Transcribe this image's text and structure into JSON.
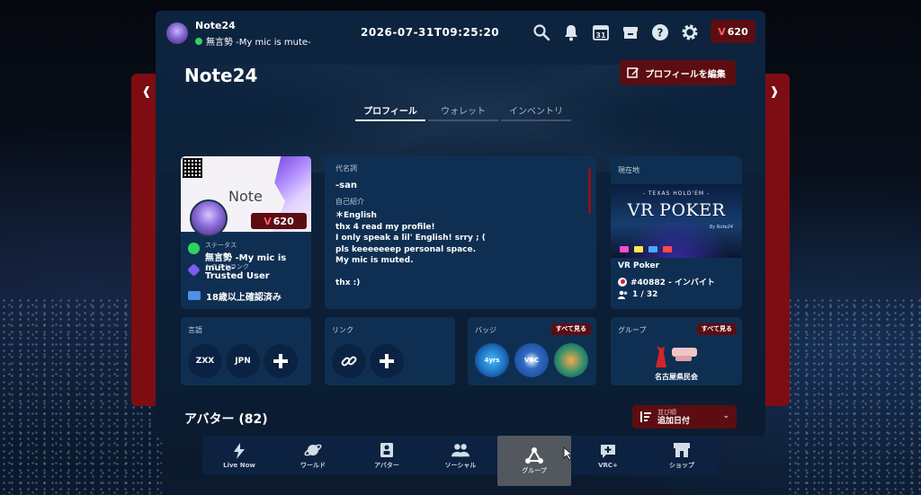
{
  "topbar": {
    "user_name": "Note24",
    "status_text": "無言勢 -My mic is mute-",
    "datetime": "2026-07-31T09:25:20",
    "credits": "620",
    "icons": [
      "search-icon",
      "bell-icon",
      "calendar-icon",
      "archive-icon",
      "help-icon",
      "gear-icon"
    ],
    "calendar_day": "31"
  },
  "profile": {
    "title": "Note24",
    "edit_button": "プロフィールを編集",
    "tabs": [
      "プロフィール",
      "ウォレット",
      "インベントリ"
    ],
    "banner_text": "Note",
    "credits": "620",
    "status_label": "ステータス",
    "status_value": "無言勢 -My mic is mute-",
    "trust_label": "トラストランク",
    "trust_value": "Trusted User",
    "age_verified": "18歳以上確認済み"
  },
  "bio": {
    "pronoun_label": "代名詞",
    "pronoun_value": "-san",
    "intro_label": "自己紹介",
    "intro_text": "＊English\nthx 4 read my profile!\nI only speak a lil' English! srry ; (\npls keeeeeeep personal space.\nMy mic is muted.\n\nthx :)"
  },
  "location": {
    "label": "現在地",
    "image_top": "- TEXAS HOLD'EM -",
    "image_title": "VR POKER",
    "image_by": "By Note24",
    "world_name": "VR Poker",
    "instance": "#40882 - インバイト",
    "users": "1 / 32"
  },
  "languages": {
    "label": "言語",
    "items": [
      "ZXX",
      "JPN"
    ]
  },
  "links": {
    "label": "リンク"
  },
  "badges": {
    "label": "バッジ",
    "see_all": "すべて見る",
    "badge_texts": [
      "4yrs",
      "VRC",
      ""
    ]
  },
  "groups": {
    "label": "グループ",
    "see_all": "すべて見る",
    "group_name": "名古屋県民会"
  },
  "avatars": {
    "title": "アバター (82)",
    "sort_label": "並び順",
    "sort_value": "追加日付"
  },
  "nav": [
    {
      "label": "Live Now",
      "icon": "lightning-icon"
    },
    {
      "label": "ワールド",
      "icon": "planet-icon"
    },
    {
      "label": "アバター",
      "icon": "avatar-icon"
    },
    {
      "label": "ソーシャル",
      "icon": "people-icon"
    },
    {
      "label": "グループ",
      "icon": "group-icon"
    },
    {
      "label": "VRC+",
      "icon": "vrcplus-icon"
    },
    {
      "label": "ショップ",
      "icon": "shop-icon"
    }
  ],
  "colors": {
    "accent_red": "#5c0d12",
    "panel_blue": "#0f2f52",
    "status_green": "#2ed45f"
  }
}
